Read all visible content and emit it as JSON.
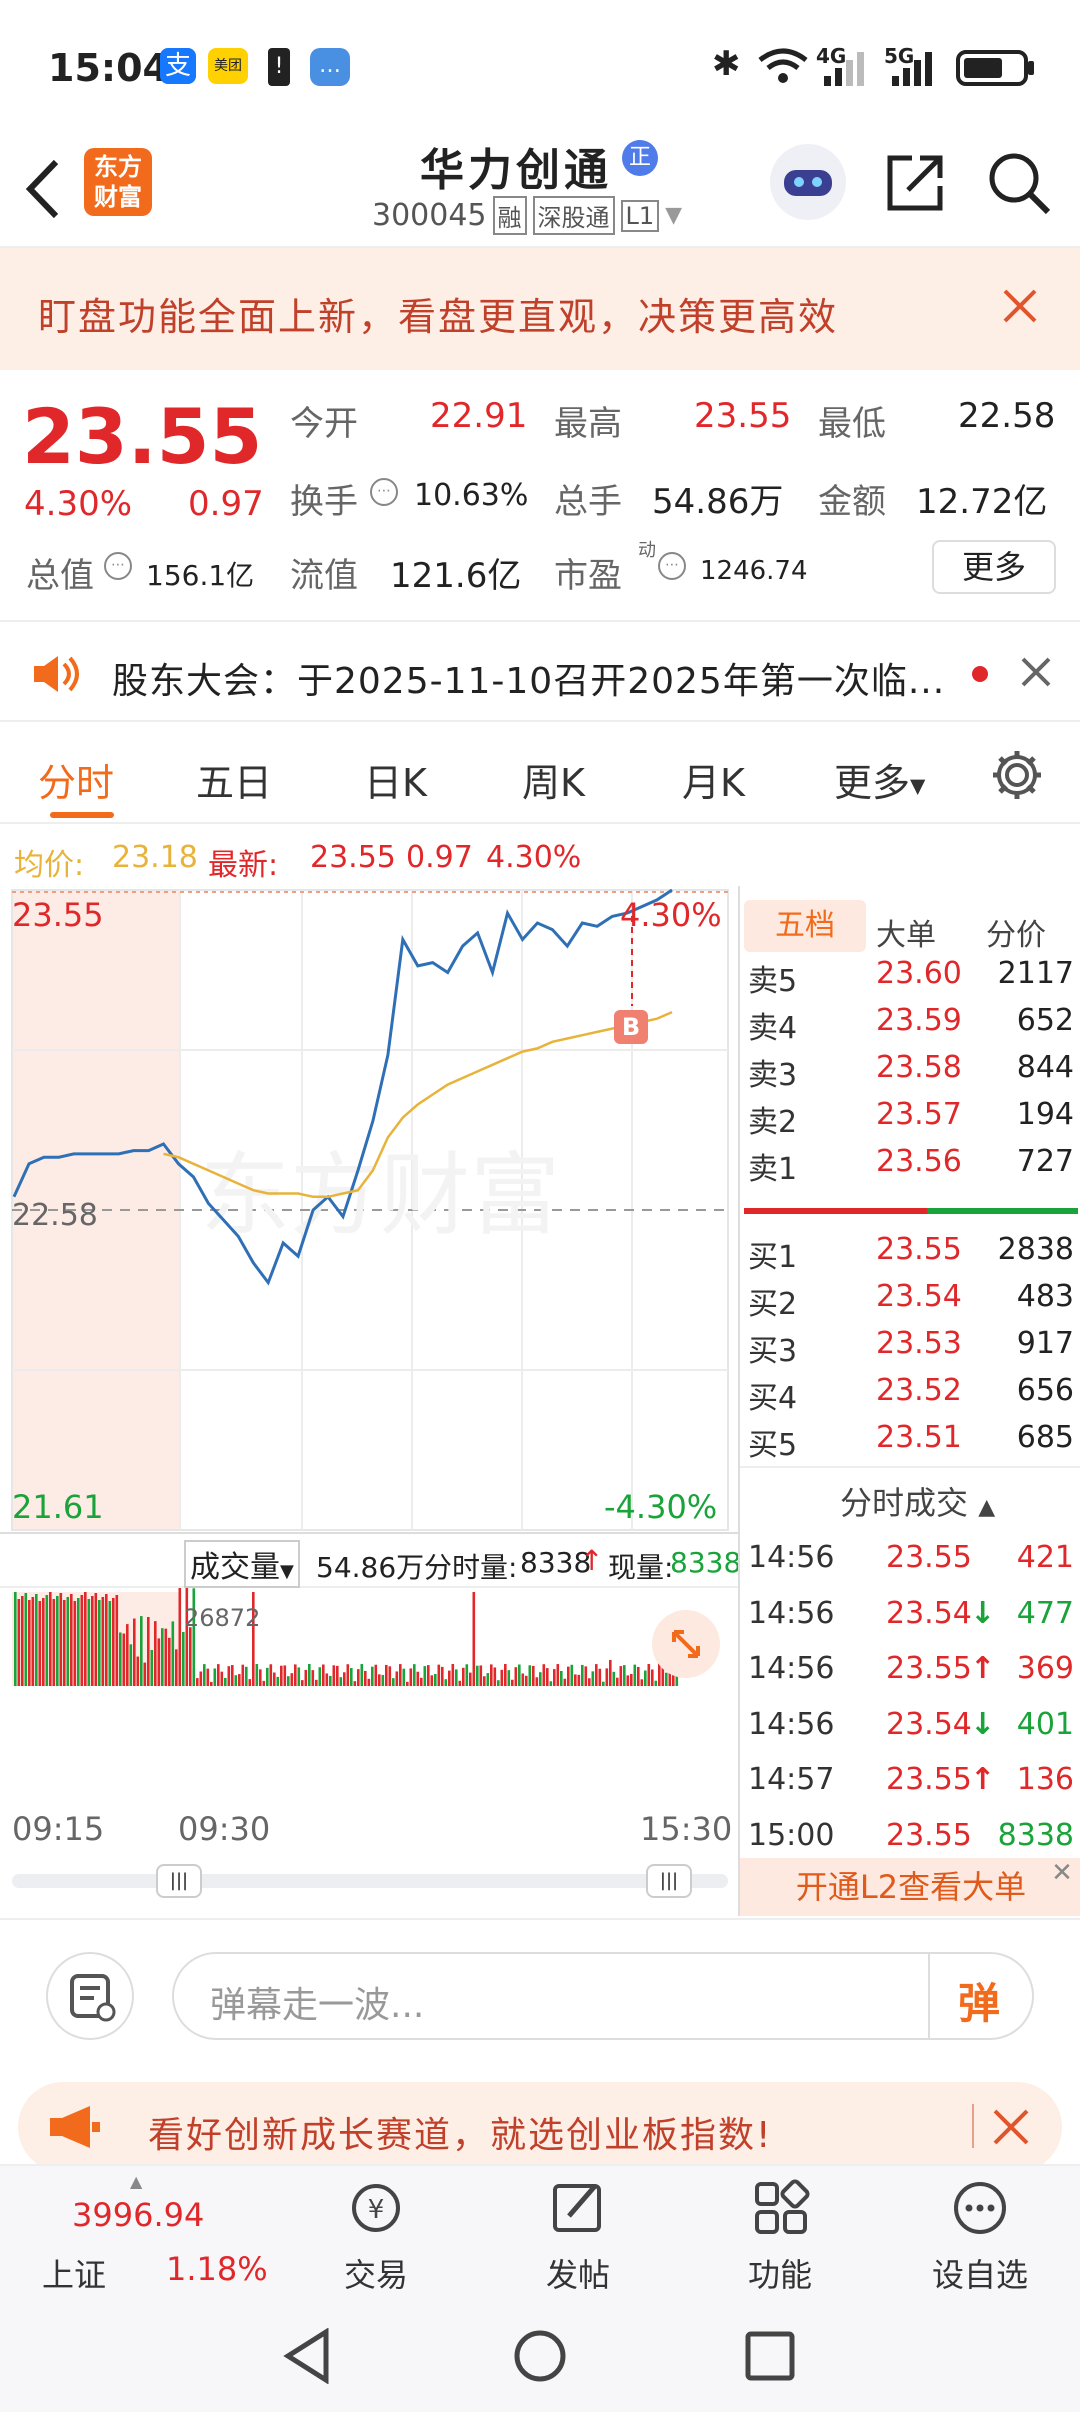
{
  "status_bar": {
    "time": "15:04",
    "network_1": "4G",
    "network_2": "5G",
    "app_icons": [
      "alipay-icon",
      "meituan-icon",
      "battery-alert-icon",
      "message-icon"
    ]
  },
  "header": {
    "logo_text": "东方财富",
    "stock_name": "华力创通",
    "name_badge": "正",
    "stock_code": "300045",
    "tags": [
      "融",
      "深股通",
      "L1"
    ]
  },
  "banner": {
    "text": "盯盘功能全面上新，看盘更直观，决策更高效"
  },
  "quote": {
    "price": "23.55",
    "change_pct": "4.30%",
    "change": "0.97",
    "open_label": "今开",
    "open": "22.91",
    "high_label": "最高",
    "high": "23.55",
    "low_label": "最低",
    "low": "22.58",
    "turnover_label": "换手",
    "turnover": "10.63%",
    "volume_label": "总手",
    "volume": "54.86万",
    "amount_label": "金额",
    "amount": "12.72亿",
    "total_mv_label": "总值",
    "total_mv": "156.1亿",
    "float_mv_label": "流值",
    "float_mv": "121.6亿",
    "pe_label": "市盈",
    "pe_sup": "动",
    "pe": "1246.74",
    "more_label": "更多"
  },
  "notice": {
    "text": "股东大会：于2025-11-10召开2025年第一次临..."
  },
  "tabs": {
    "items": [
      "分时",
      "五日",
      "日K",
      "周K",
      "月K",
      "更多"
    ],
    "active": "分时"
  },
  "avg_line": {
    "avg_label": "均价:",
    "avg": "23.18",
    "latest_label": "最新:",
    "latest": "23.55",
    "change": "0.97",
    "pct": "4.30%"
  },
  "chart": {
    "price_top": "23.55",
    "price_bottom": "21.61",
    "pct_top": "4.30%",
    "pct_bottom": "-4.30%",
    "ref_price": "22.58",
    "marker": "B",
    "vol_label": "成交量",
    "vol_total": "54.86万",
    "fenshi_label": "分时量:",
    "fenshi_value": "8338",
    "now_label": "现量:",
    "now_value": "8338",
    "vol_max": "26872",
    "time_start": "09:15",
    "time_mid": "09:30",
    "time_end": "15:30"
  },
  "chart_data": {
    "type": "line",
    "series": [
      {
        "name": "最新",
        "values": [
          22.62,
          22.72,
          22.74,
          22.74,
          22.75,
          22.75,
          22.75,
          22.75,
          22.76,
          22.76,
          22.78,
          22.72,
          22.68,
          22.6,
          22.55,
          22.5,
          22.42,
          22.36,
          22.48,
          22.44,
          22.58,
          22.62,
          22.56,
          22.7,
          22.85,
          23.05,
          23.4,
          23.32,
          23.33,
          23.3,
          23.38,
          23.42,
          23.3,
          23.48,
          23.4,
          23.45,
          23.43,
          23.38,
          23.45,
          23.44,
          23.47,
          23.48,
          23.5,
          23.52,
          23.55
        ]
      },
      {
        "name": "均价",
        "values": [
          null,
          null,
          null,
          null,
          null,
          null,
          null,
          null,
          null,
          null,
          22.75,
          22.74,
          22.72,
          22.7,
          22.68,
          22.66,
          22.64,
          22.63,
          22.63,
          22.63,
          22.62,
          22.62,
          22.63,
          22.64,
          22.7,
          22.8,
          22.86,
          22.9,
          22.93,
          22.96,
          22.98,
          23.0,
          23.02,
          23.04,
          23.06,
          23.07,
          23.09,
          23.1,
          23.11,
          23.12,
          23.13,
          23.14,
          23.15,
          23.16,
          23.18
        ]
      }
    ],
    "ylim": [
      21.61,
      23.55
    ],
    "yref": 22.58
  },
  "order_book": {
    "tabs": [
      "五档",
      "大单",
      "分价"
    ],
    "asks": [
      {
        "label": "卖5",
        "price": "23.60",
        "vol": "2117"
      },
      {
        "label": "卖4",
        "price": "23.59",
        "vol": "652"
      },
      {
        "label": "卖3",
        "price": "23.58",
        "vol": "844"
      },
      {
        "label": "卖2",
        "price": "23.57",
        "vol": "194"
      },
      {
        "label": "卖1",
        "price": "23.56",
        "vol": "727"
      }
    ],
    "bids": [
      {
        "label": "买1",
        "price": "23.55",
        "vol": "2838"
      },
      {
        "label": "买2",
        "price": "23.54",
        "vol": "483"
      },
      {
        "label": "买3",
        "price": "23.53",
        "vol": "917"
      },
      {
        "label": "买4",
        "price": "23.52",
        "vol": "656"
      },
      {
        "label": "买5",
        "price": "23.51",
        "vol": "685"
      }
    ],
    "trades_title": "分时成交",
    "trades": [
      {
        "time": "14:56",
        "price": "23.55",
        "arrow": "",
        "vol": "421",
        "pcolor": "red",
        "vcolor": "red"
      },
      {
        "time": "14:56",
        "price": "23.54",
        "arrow": "↓",
        "vol": "477",
        "pcolor": "red",
        "vcolor": "green"
      },
      {
        "time": "14:56",
        "price": "23.55",
        "arrow": "↑",
        "vol": "369",
        "pcolor": "red",
        "vcolor": "red"
      },
      {
        "time": "14:56",
        "price": "23.54",
        "arrow": "↓",
        "vol": "401",
        "pcolor": "red",
        "vcolor": "green"
      },
      {
        "time": "14:57",
        "price": "23.55",
        "arrow": "↑",
        "vol": "136",
        "pcolor": "red",
        "vcolor": "red"
      },
      {
        "time": "15:00",
        "price": "23.55",
        "arrow": "",
        "vol": "8338",
        "pcolor": "red",
        "vcolor": "green"
      }
    ],
    "l2_label": "开通L2查看大单"
  },
  "comment": {
    "placeholder": "弹幕走一波...",
    "danmu": "弹"
  },
  "ad": {
    "text": "看好创新成长赛道，就选创业板指数!"
  },
  "bottom_nav": {
    "index_value": "3996.94",
    "index_name": "上证",
    "index_pct": "1.18%",
    "items": [
      "交易",
      "发帖",
      "功能",
      "设自选"
    ]
  },
  "colors": {
    "up": "#e0282b",
    "down": "#19a33a",
    "line": "#2f6fb5",
    "avg": "#e8b33a",
    "brand": "#f26b1d"
  }
}
